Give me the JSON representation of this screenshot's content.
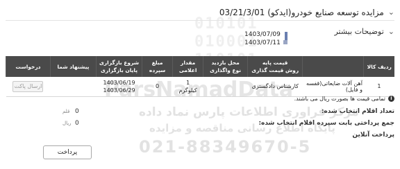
{
  "header": {
    "title": "مزایده توسعه صنایع خودرو(ایدکو) 03/21/3/01"
  },
  "description": {
    "label": "توضیحات بیشتر"
  },
  "dates": {
    "start": "1403/07/09",
    "end": "1403/07/11"
  },
  "table": {
    "columns": [
      "ردیف کالا",
      "",
      "قیمت پایه\nروش قیمت گذاری",
      "محل بازدید\nنوع واگذاری",
      "مقدار اعلامی",
      "مبلغ سپرده",
      "شروع بازگزاری\nپایان بازگزاری",
      "پیشنهاد شما",
      "درخواست"
    ],
    "rows": [
      {
        "index": "1",
        "item": "آهن آلات ضایعاتی(قفسه و فایل)",
        "pricing_method": "کارشناس دادگستری",
        "delivery": "",
        "quantity": "1\nکیلوگرم",
        "deposit": "0",
        "start": "1403/06/19",
        "end": "1403/06/29",
        "offer": "",
        "action_label": "ارسال پاکت"
      }
    ]
  },
  "note": "تمامی قیمت ها بصورت ریال می باشند.",
  "summary": {
    "selected_count_label": "تعداد اقلام انتخاب شده:",
    "selected_count": "0",
    "selected_count_unit": "قلم",
    "deposit_total_label": "جمع پرداختی بابت سپرده اقلام انتخاب شده:",
    "deposit_total": "0",
    "deposit_total_unit": "ریال"
  },
  "online_payment": "پرداخت آنلاین",
  "pay_button": "پرداخت",
  "watermark": {
    "digits": "010101\n010001\n110101",
    "brand": "ParsNamadData",
    "line1": "مرکز فراوری اطلاعات پارس نماد داده",
    "line2": "پایگاه اطلاع رسانی مناقصه و مزایده",
    "phone": "021-88349670-5"
  }
}
